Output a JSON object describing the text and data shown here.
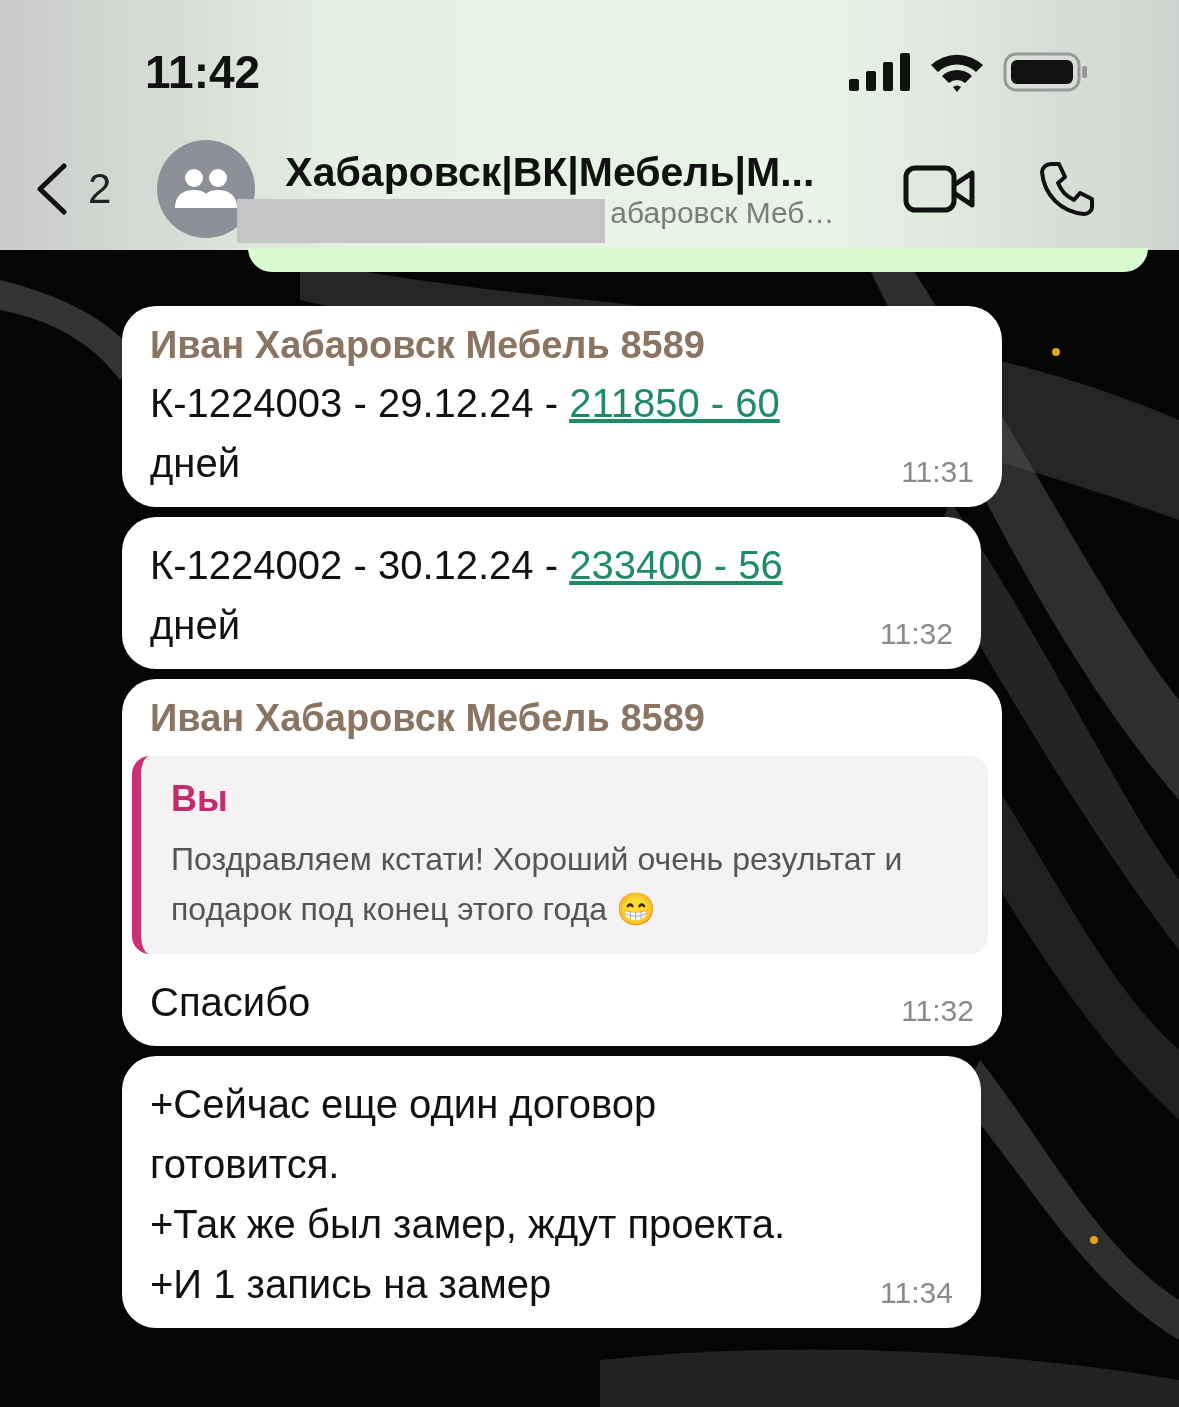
{
  "status_bar": {
    "time": "11:42"
  },
  "header": {
    "back_count": "2",
    "title": "Хабаровск|ВК|Мебель|М...",
    "subtitle": "абаровск Меб…"
  },
  "messages": [
    {
      "sender": "Иван Хабаровск Мебель 8589",
      "parts": [
        {
          "kind": "text",
          "text": "К-1224003 - 29.12.24 - "
        },
        {
          "kind": "link",
          "text": "211850 - 60"
        },
        {
          "kind": "text",
          "text": " дней"
        }
      ],
      "time": "11:31"
    },
    {
      "parts": [
        {
          "kind": "text",
          "text": "К-1224002 - 30.12.24 - "
        },
        {
          "kind": "link",
          "text": "233400 - 56"
        },
        {
          "kind": "text",
          "text": " дней"
        }
      ],
      "time": "11:32"
    },
    {
      "sender": "Иван Хабаровск Мебель 8589",
      "quote": {
        "author": "Вы",
        "text": "Поздравляем кстати! Хороший очень результат и подарок под конец этого года 😁"
      },
      "parts": [
        {
          "kind": "text",
          "text": "Спасибо"
        }
      ],
      "time": "11:32"
    },
    {
      "parts": [
        {
          "kind": "text",
          "text": "+Сейчас еще один договор готовится.\n+Так же был замер, ждут проекта.\n+И 1 запись на замер"
        }
      ],
      "time": "11:34"
    }
  ]
}
